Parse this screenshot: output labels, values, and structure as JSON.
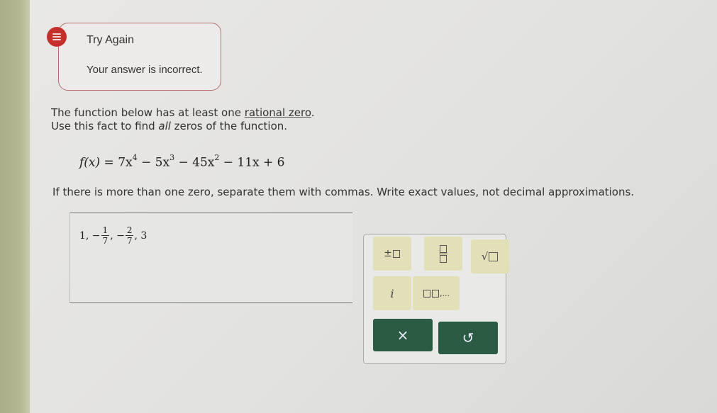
{
  "feedback": {
    "title": "Try Again",
    "message": "Your answer is incorrect."
  },
  "question": {
    "line1_prefix": "The function below has at least one ",
    "line1_link": "rational zero",
    "line1_suffix": ".",
    "line2_prefix": "Use this fact to find ",
    "line2_emph": "all",
    "line2_suffix": " zeros of the function.",
    "function_lhs": "f(x) = ",
    "term1": "7x",
    "term1_exp": "4",
    "term2": " − 5x",
    "term2_exp": "3",
    "term3": " − 45x",
    "term3_exp": "2",
    "term4": " − 11x + 6",
    "instructions": "If there is more than one zero, separate them with commas. Write exact values, not decimal approximations."
  },
  "answer": {
    "part1": "1, −",
    "frac1_num": "1",
    "frac1_den": "7",
    "part2": ", −",
    "frac2_num": "2",
    "frac2_den": "7",
    "part3": ", 3"
  },
  "keypad": {
    "plus_minus": "±",
    "imaginary": "i",
    "list_ellipsis": ",...",
    "clear_label": "×",
    "undo_label": "↺"
  },
  "colors": {
    "error_icon": "#c4302b",
    "key_bg": "#e3dfb8",
    "action_button": "#2b5b42"
  }
}
